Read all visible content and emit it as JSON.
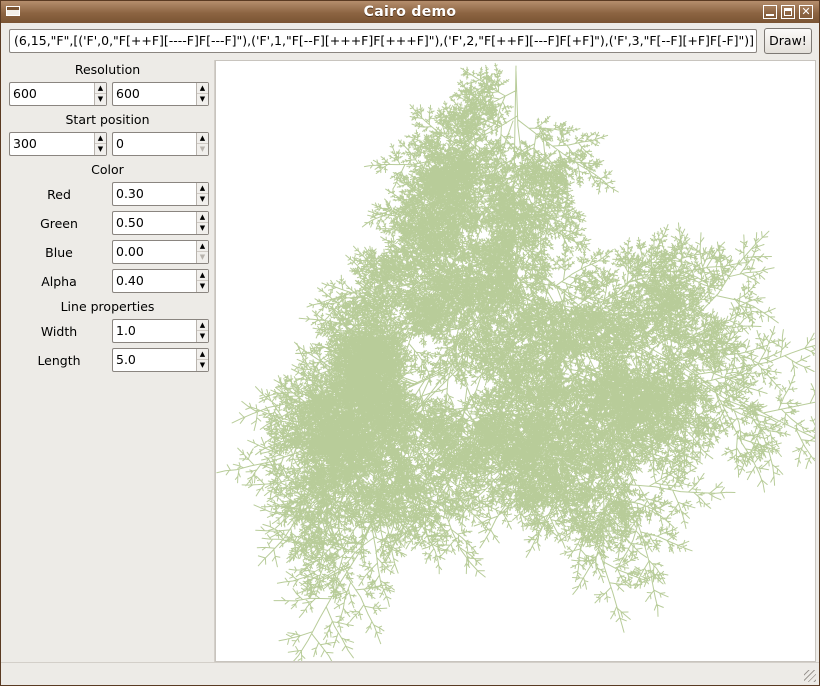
{
  "window": {
    "title": "Cairo demo"
  },
  "toolbar": {
    "formula_value": "(6,15,\"F\",[('F',0,\"F[++F][----F]F[---F]\"),('F',1,\"F[--F][+++F]F[+++F]\"),('F',2,\"F[++F][---F]F[+F]\"),('F',3,\"F[--F][+F]F[-F]\")]",
    "draw_label": "Draw!"
  },
  "sidebar": {
    "resolution": {
      "label": "Resolution",
      "width": "600",
      "height": "600"
    },
    "start_position": {
      "label": "Start position",
      "x": "300",
      "y": "0"
    },
    "color": {
      "label": "Color",
      "red_label": "Red",
      "red": "0.30",
      "green_label": "Green",
      "green": "0.50",
      "blue_label": "Blue",
      "blue": "0.00",
      "alpha_label": "Alpha",
      "alpha": "0.40"
    },
    "line": {
      "label": "Line properties",
      "width_label": "Width",
      "width": "1.0",
      "length_label": "Length",
      "length": "5.0"
    }
  },
  "colors": {
    "titlebar": "#8c6442",
    "stroke": "#4d8000"
  },
  "icons": {
    "window_menu": "window-menu-icon",
    "minimize": "minimize-icon",
    "maximize": "maximize-icon",
    "close": "close-icon",
    "spin_up": "spin-up-icon",
    "spin_down": "spin-down-icon",
    "resize_grip": "resize-grip-icon"
  }
}
